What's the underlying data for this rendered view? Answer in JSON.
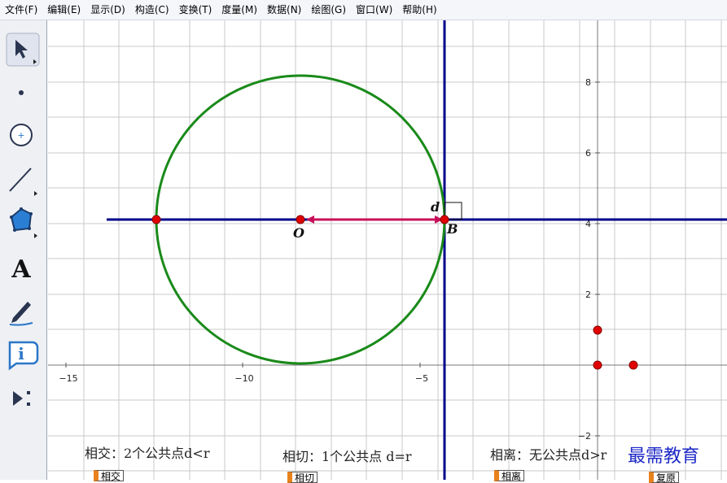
{
  "menubar": {
    "items": [
      "文件(F)",
      "编辑(E)",
      "显示(D)",
      "构造(C)",
      "变换(T)",
      "度量(M)",
      "数据(N)",
      "绘图(G)",
      "窗口(W)",
      "帮助(H)"
    ]
  },
  "toolbox": {
    "tools": [
      "arrow-select-icon",
      "point-tool-icon",
      "compass-icon",
      "straightedge-icon",
      "polygon-icon",
      "text-tool-icon",
      "marker-pen-icon",
      "info-icon",
      "custom-tool-icon"
    ],
    "text_tool_glyph": "A",
    "info_tool_glyph": "i"
  },
  "graph": {
    "x_ticks": [
      "−15",
      "−10",
      "−5"
    ],
    "y_ticks": [
      "8",
      "6",
      "4",
      "2",
      "−2"
    ],
    "point_labels": {
      "center": "O",
      "tangent_point": "B",
      "distance": "d"
    },
    "colors": {
      "circle": "#1a8a1a",
      "axes": "#00008b",
      "segment": "#c8105a",
      "points": "#e00000",
      "grid": "#c8c8c8"
    }
  },
  "captions": {
    "intersect": "相交：2个公共点d<r",
    "tangent": "相切：1个公共点 d=r",
    "separate": "相离：无公共点d>r"
  },
  "buttons": {
    "intersect": "相交",
    "tangent": "相切",
    "separate": "相离",
    "reset": "复原"
  },
  "watermark": "最需教育"
}
